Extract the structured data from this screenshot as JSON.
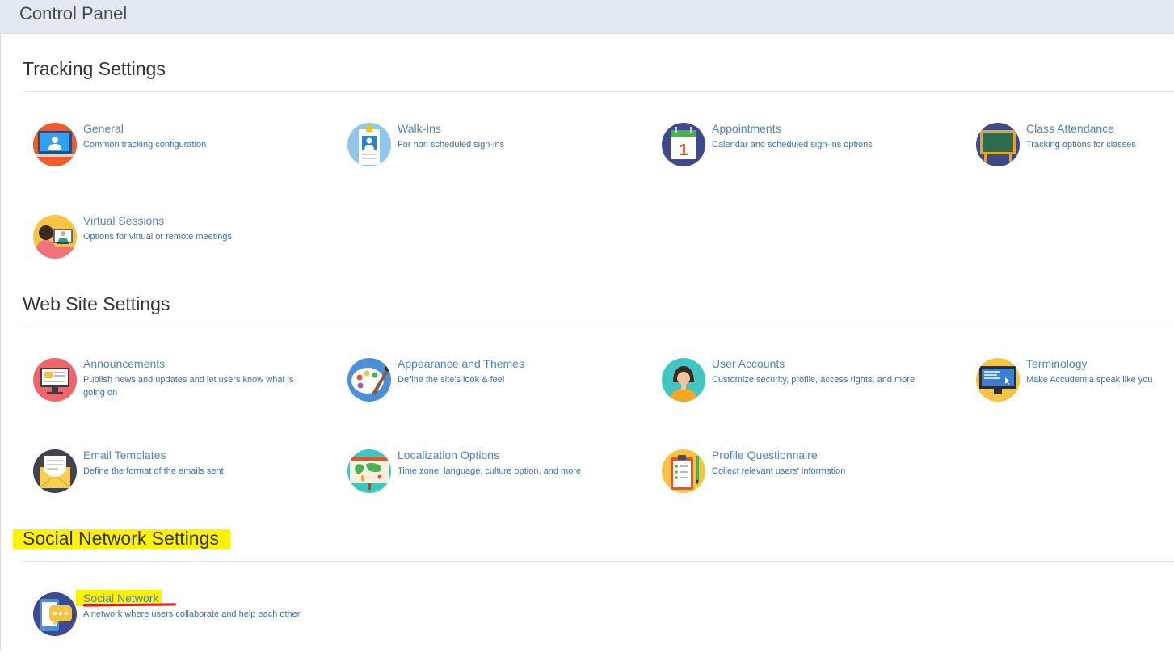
{
  "header": {
    "title": "Control Panel"
  },
  "sections": [
    {
      "title": "Tracking Settings",
      "items": [
        {
          "title": "General",
          "desc": "Common tracking configuration",
          "icon": "laptop-user-icon"
        },
        {
          "title": "Walk-Ins",
          "desc": "For non scheduled sign-ins",
          "icon": "badge-icon"
        },
        {
          "title": "Appointments",
          "desc": "Calendar and scheduled sign-ins options",
          "icon": "calendar-icon"
        },
        {
          "title": "Class Attendance",
          "desc": "Tracking options for classes",
          "icon": "chalkboard-icon"
        },
        {
          "title": "Virtual Sessions",
          "desc": "Options for virtual or remote meetings",
          "icon": "video-call-icon"
        }
      ]
    },
    {
      "title": "Web Site Settings",
      "items": [
        {
          "title": "Announcements",
          "desc": "Publish news and updates and let users know what is going on",
          "icon": "megaphone-icon"
        },
        {
          "title": "Appearance and Themes",
          "desc": "Define the site's look & feel",
          "icon": "palette-icon"
        },
        {
          "title": "User Accounts",
          "desc": "Customize security, profile, access rights, and more",
          "icon": "user-avatar-icon"
        },
        {
          "title": "Terminology",
          "desc": "Make Accudemia speak like you",
          "icon": "monitor-icon"
        },
        {
          "title": "Email Templates",
          "desc": "Define the format of the emails sent",
          "icon": "envelope-icon"
        },
        {
          "title": "Localization Options",
          "desc": "Time zone, language, culture option, and more",
          "icon": "world-map-icon"
        },
        {
          "title": "Profile Questionnaire",
          "desc": "Collect relevant users' information",
          "icon": "clipboard-icon"
        }
      ]
    },
    {
      "title": "Social Network Settings",
      "items": [
        {
          "title": "Social Network",
          "desc": "A network where users collaborate and help each other",
          "icon": "chat-bubble-icon"
        }
      ]
    }
  ],
  "annotations": {
    "highlight_color": "#fff200",
    "underline_color": "#e21b1b"
  },
  "colors": {
    "link": "#4a86c5",
    "header_bg": "#e3e9f1"
  }
}
